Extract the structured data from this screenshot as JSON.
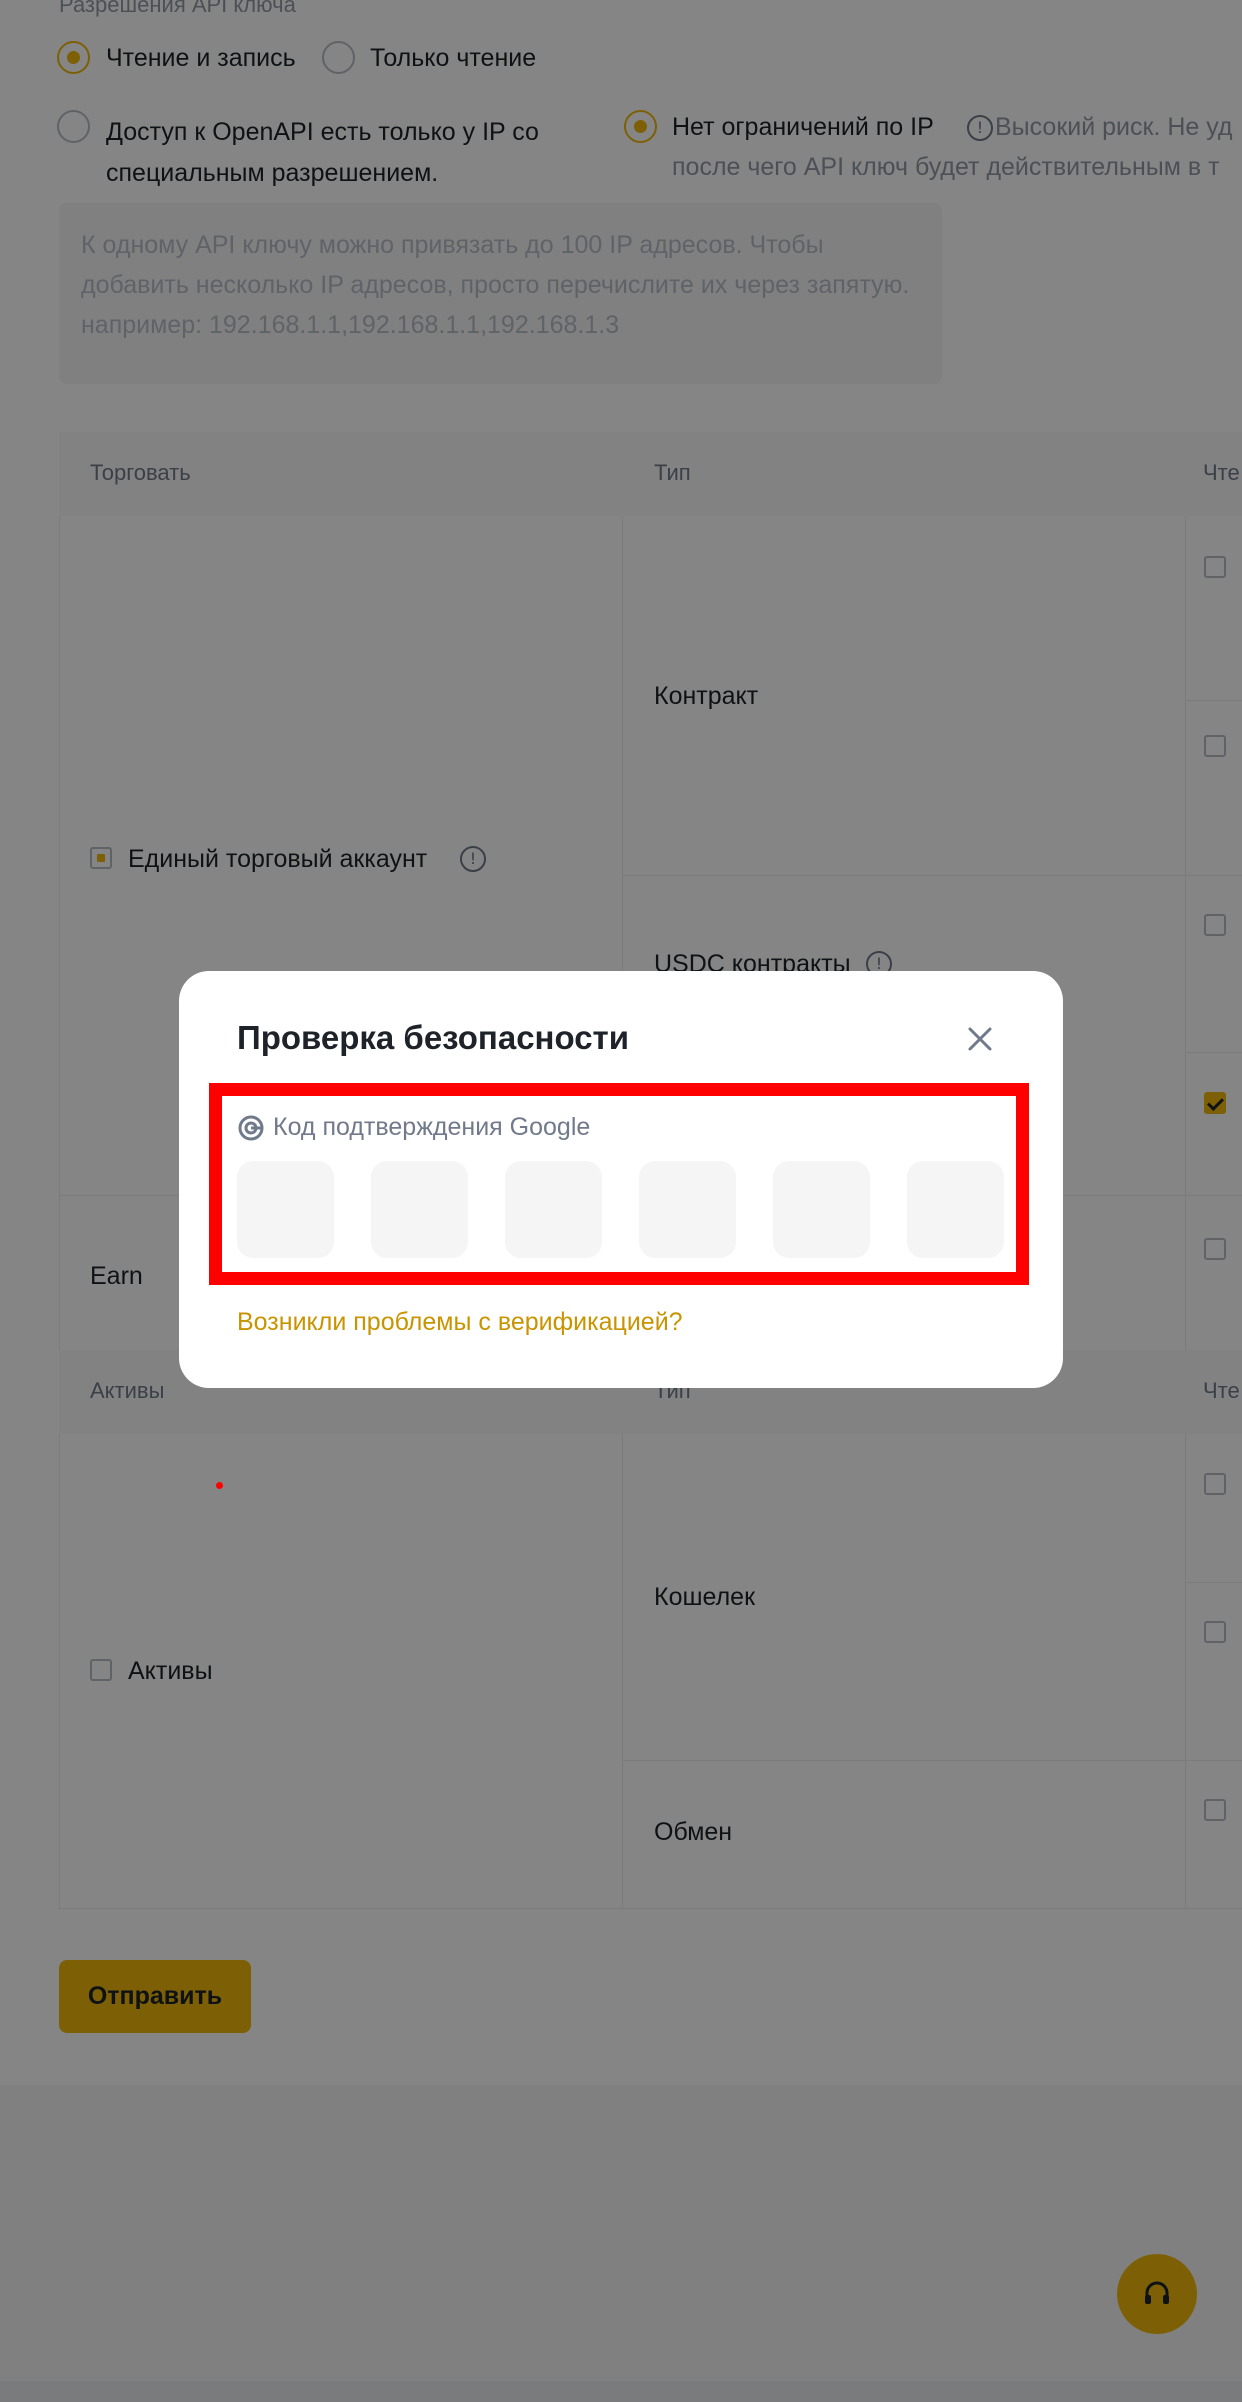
{
  "permissions": {
    "section_label": "Разрешения API ключа",
    "rw_option": "Чтение и запись",
    "ro_option": "Только чтение",
    "ip_restricted_option": "Доступ к OpenAPI есть только у IP со специальным разрешением.",
    "no_ip_option": "Нет ограничений по IP",
    "warning_line1": "Высокий риск. Не уд",
    "warning_line2": "после чего API ключ будет действительным в т",
    "ip_placeholder": "К одному API ключу можно привязать до 100 IP адресов. Чтобы добавить несколько IP адресов, просто перечислите их через запятую.",
    "ip_example": "например: 192.168.1.1,192.168.1.1,192.168.1.3"
  },
  "trade_table": {
    "col_trade": "Торговать",
    "col_type": "Тип",
    "col_read": "Чте",
    "account_label": "Единый торговый аккаунт",
    "row_contract": "Контракт",
    "row_usdc": "USDC контракты",
    "row_earn": "Earn"
  },
  "assets_table": {
    "col_assets": "Активы",
    "col_type": "Тип",
    "col_read": "Чте",
    "assets_label": "Активы",
    "row_wallet": "Кошелек",
    "row_exchange": "Обмен"
  },
  "submit_label": "Отправить",
  "modal": {
    "title": "Проверка безопасности",
    "code_label": "Код подтверждения Google",
    "code_digits": [
      "",
      "",
      "",
      "",
      "",
      ""
    ],
    "trouble_link": "Возникли проблемы с верификацией?"
  },
  "colors": {
    "accent": "#f0b90b",
    "link": "#c99400",
    "highlight": "#ff0000"
  }
}
